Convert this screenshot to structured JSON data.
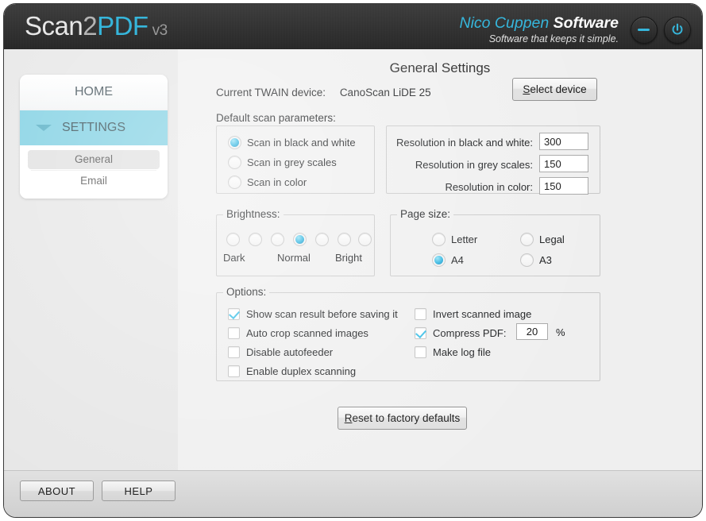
{
  "titlebar": {
    "logo": {
      "part1": "Scan",
      "part2": "2",
      "part3": "PDF",
      "version": "v3"
    },
    "brand": {
      "name_accent": "Nico Cuppen",
      "name_bold": "Software",
      "tagline": "Software that keeps it simple."
    },
    "minimize_label": "Minimize",
    "power_label": "Exit"
  },
  "sidebar": {
    "items": [
      {
        "label": "HOME"
      },
      {
        "label": "SETTINGS"
      }
    ],
    "subitems": [
      {
        "label": "General",
        "selected": true
      },
      {
        "label": "Email",
        "selected": false
      }
    ]
  },
  "main": {
    "title": "General Settings",
    "twain_label": "Current TWAIN device:",
    "twain_value": "CanoScan LiDE 25",
    "select_device_button": {
      "accel": "S",
      "rest": "elect device"
    },
    "default_params_caption": "Default scan parameters:",
    "scan_mode": {
      "options": [
        {
          "label": "Scan in black and white",
          "checked": true
        },
        {
          "label": "Scan in grey scales",
          "checked": false
        },
        {
          "label": "Scan in color",
          "checked": false
        }
      ]
    },
    "resolution": {
      "rows": [
        {
          "label": "Resolution in black and white:",
          "value": "300"
        },
        {
          "label": "Resolution in grey scales:",
          "value": "150"
        },
        {
          "label": "Resolution in color:",
          "value": "150"
        }
      ]
    },
    "brightness": {
      "legend": "Brightness:",
      "ticks": 7,
      "selected_index": 3,
      "label_dark": "Dark",
      "label_normal": "Normal",
      "label_bright": "Bright"
    },
    "page_size": {
      "legend": "Page size:",
      "options": [
        {
          "label": "Letter",
          "checked": false
        },
        {
          "label": "Legal",
          "checked": false
        },
        {
          "label": "A4",
          "checked": true
        },
        {
          "label": "A3",
          "checked": false
        }
      ]
    },
    "options": {
      "legend": "Options:",
      "left": [
        {
          "label": "Show scan result before saving it",
          "checked": true
        },
        {
          "label": "Auto crop scanned images",
          "checked": false
        },
        {
          "label": "Disable autofeeder",
          "checked": false
        },
        {
          "label": "Enable duplex scanning",
          "checked": false
        }
      ],
      "right": [
        {
          "label": "Invert scanned image",
          "checked": false
        },
        {
          "label": "Compress PDF:",
          "checked": true
        },
        {
          "label": "Make log file",
          "checked": false
        }
      ],
      "compress_value": "20",
      "compress_unit": "%"
    },
    "reset_button": {
      "accel": "R",
      "rest": "eset to factory defaults"
    }
  },
  "footer": {
    "about_label": "ABOUT",
    "help_label": "HELP"
  },
  "colors": {
    "accent_cyan": "#34b7dd",
    "nav_highlight": "#7dcfe2",
    "titlebar_dark": "#333333"
  }
}
